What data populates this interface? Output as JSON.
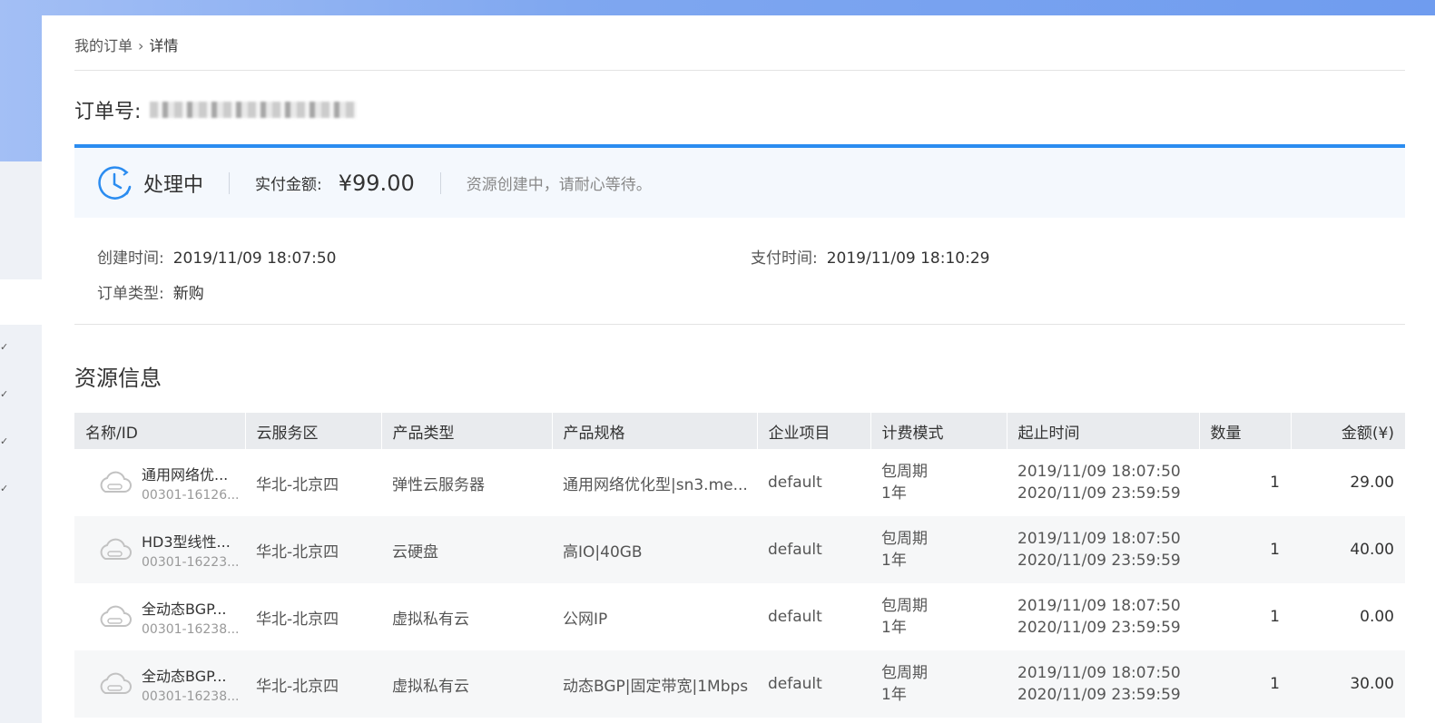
{
  "breadcrumb": {
    "parent": "我的订单",
    "separator": "›",
    "current": "详情"
  },
  "order": {
    "label": "订单号:"
  },
  "status": {
    "label": "处理中",
    "amount_label": "实付金额:",
    "amount_value": "¥99.00",
    "tip": "资源创建中，请耐心等待。"
  },
  "info": {
    "created_label": "创建时间:",
    "created_value": "2019/11/09 18:07:50",
    "paid_label": "支付时间:",
    "paid_value": "2019/11/09 18:10:29",
    "type_label": "订单类型:",
    "type_value": "新购"
  },
  "resources": {
    "title": "资源信息",
    "columns": [
      "名称/ID",
      "云服务区",
      "产品类型",
      "产品规格",
      "企业项目",
      "计费模式",
      "起止时间",
      "数量",
      "金额(¥)"
    ],
    "rows": [
      {
        "name": "通用网络优...",
        "id": "00301-16126...",
        "region": "华北-北京四",
        "product": "弹性云服务器",
        "spec": "通用网络优化型|sn3.me...",
        "project": "default",
        "billing": "包周期",
        "duration": "1年",
        "start": "2019/11/09 18:07:50",
        "end": "2020/11/09 23:59:59",
        "qty": "1",
        "amount": "29.00"
      },
      {
        "name": "HD3型线性...",
        "id": "00301-16223...",
        "region": "华北-北京四",
        "product": "云硬盘",
        "spec": "高IO|40GB",
        "project": "default",
        "billing": "包周期",
        "duration": "1年",
        "start": "2019/11/09 18:07:50",
        "end": "2020/11/09 23:59:59",
        "qty": "1",
        "amount": "40.00"
      },
      {
        "name": "全动态BGP...",
        "id": "00301-16238...",
        "region": "华北-北京四",
        "product": "虚拟私有云",
        "spec": "公网IP",
        "project": "default",
        "billing": "包周期",
        "duration": "1年",
        "start": "2019/11/09 18:07:50",
        "end": "2020/11/09 23:59:59",
        "qty": "1",
        "amount": "0.00"
      },
      {
        "name": "全动态BGP...",
        "id": "00301-16238...",
        "region": "华北-北京四",
        "product": "虚拟私有云",
        "spec": "动态BGP|固定带宽|1Mbps",
        "project": "default",
        "billing": "包周期",
        "duration": "1年",
        "start": "2019/11/09 18:07:50",
        "end": "2020/11/09 23:59:59",
        "qty": "1",
        "amount": "30.00"
      }
    ]
  },
  "icons": {
    "status": "clock-processing-icon",
    "resource": "cloud-icon",
    "sidebar": "check-icon"
  },
  "colors": {
    "accent": "#2b8cf0",
    "status_bg": "#f4f8fd",
    "header_bg": "#e9ebee"
  }
}
